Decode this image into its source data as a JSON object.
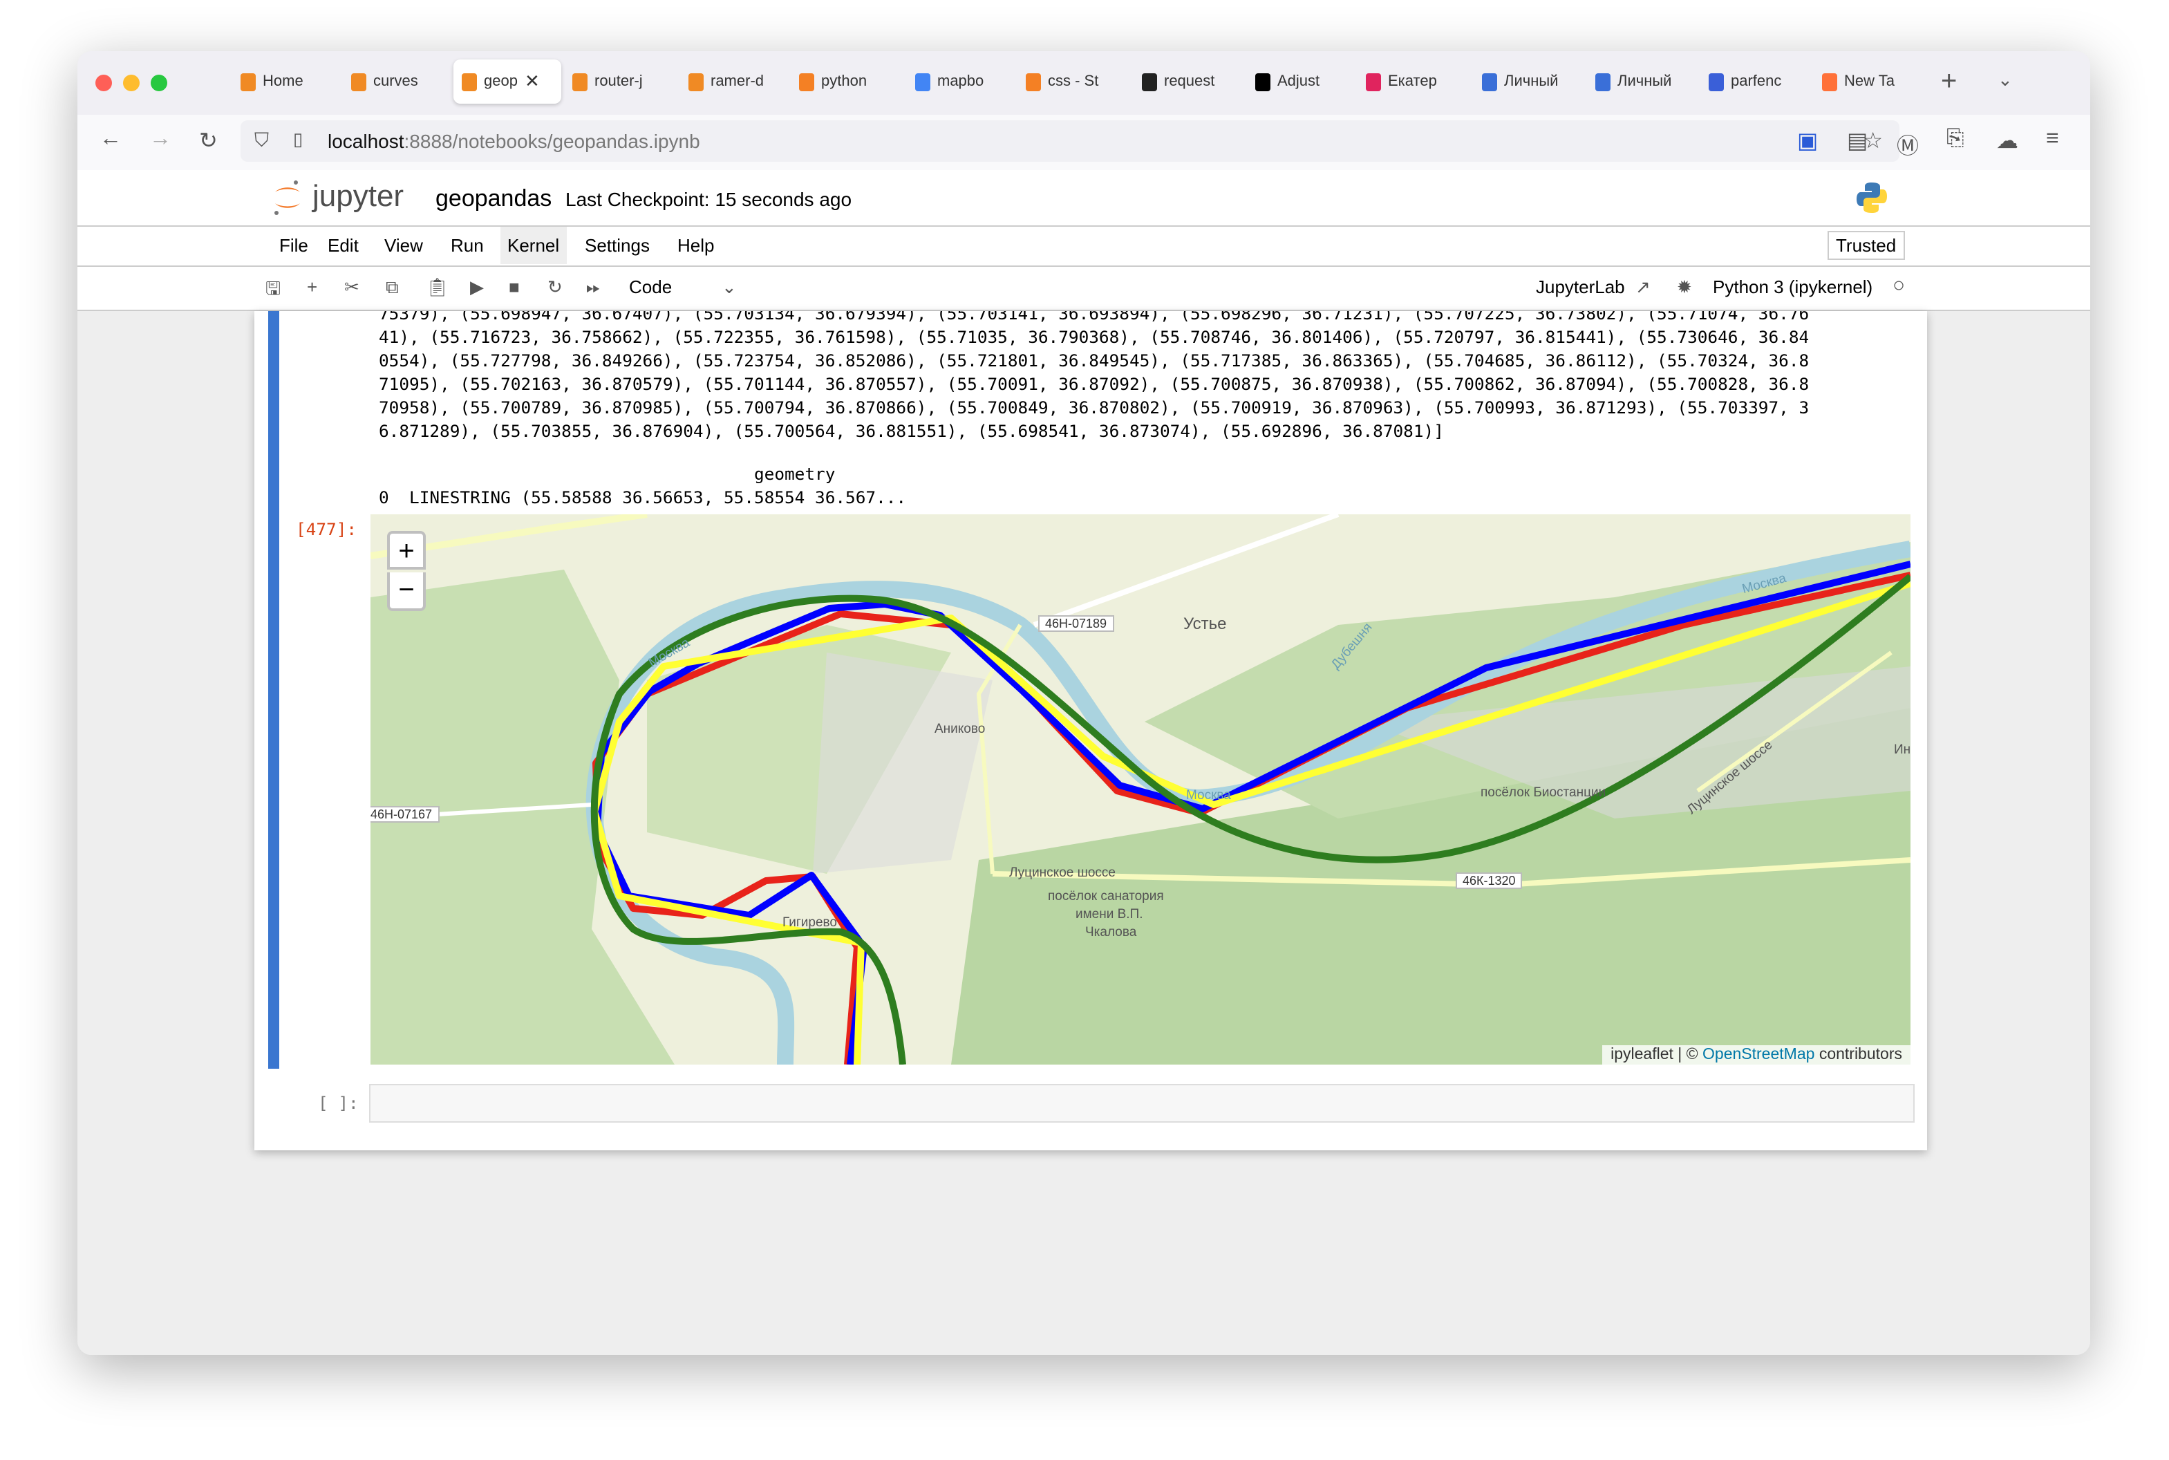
{
  "browser": {
    "tabs": [
      {
        "label": "Home",
        "icon": "jupyter-icon"
      },
      {
        "label": "curves",
        "icon": "jupyter-icon"
      },
      {
        "label": "geop",
        "icon": "jupyter-icon",
        "active": true
      },
      {
        "label": "router-j",
        "icon": "jupyter-icon"
      },
      {
        "label": "ramer-d",
        "icon": "jupyter-icon"
      },
      {
        "label": "python",
        "icon": "stackoverflow-icon"
      },
      {
        "label": "mapbo",
        "icon": "google-icon"
      },
      {
        "label": "css - St",
        "icon": "stackoverflow-icon"
      },
      {
        "label": "request",
        "icon": "github-icon"
      },
      {
        "label": "Adjust",
        "icon": "adjust-icon"
      },
      {
        "label": "Екатер",
        "icon": "app-icon"
      },
      {
        "label": "Личный",
        "icon": "chrome-like-icon"
      },
      {
        "label": "Личный",
        "icon": "chrome-like-icon"
      },
      {
        "label": "parfenc",
        "icon": "circle-icon"
      },
      {
        "label": "New Ta",
        "icon": "firefox-icon"
      }
    ],
    "url_host": "localhost",
    "url_rest": ":8888/notebooks/geopandas.ipynb"
  },
  "jupyter": {
    "logo": "jupyter",
    "notebook_name": "geopandas",
    "checkpoint": "Last Checkpoint: 15 seconds ago",
    "menu": [
      "File",
      "Edit",
      "View",
      "Run",
      "Kernel",
      "Settings",
      "Help"
    ],
    "active_menu": "Kernel",
    "trusted": "Trusted",
    "cell_type": "Code",
    "jupyterlab_link": "JupyterLab",
    "kernel": "Python 3 (ipykernel)"
  },
  "cells": {
    "output_lines": [
      "75379), (55.698947, 36.67407), (55.703134, 36.679394), (55.703141, 36.693894), (55.698296, 36.71231), (55.707225, 36.73802), (55.71074, 36.76",
      "41), (55.716723, 36.758662), (55.722355, 36.761598), (55.71035, 36.790368), (55.708746, 36.801406), (55.720797, 36.815441), (55.730646, 36.84",
      "0554), (55.727798, 36.849266), (55.723754, 36.852086), (55.721801, 36.849545), (55.717385, 36.863365), (55.704685, 36.86112), (55.70324, 36.8",
      "71095), (55.702163, 36.870579), (55.701144, 36.870557), (55.70091, 36.87092), (55.700875, 36.870938), (55.700862, 36.87094), (55.700828, 36.8",
      "70958), (55.700789, 36.870985), (55.700794, 36.870866), (55.700849, 36.870802), (55.700919, 36.870963), (55.700993, 36.871293), (55.703397, 3",
      "6.871289), (55.703855, 36.876904), (55.700564, 36.881551), (55.698541, 36.873074), (55.692896, 36.87081)]"
    ],
    "df_header": "                                     geometry",
    "df_row": "0  LINESTRING (55.58588 36.56653, 55.58554 36.567...",
    "prompt_executed": "[477]:",
    "prompt_empty": "[ ]:"
  },
  "map": {
    "zoom_in": "+",
    "zoom_out": "−",
    "attribution_prefix": "ipyleaflet | ©",
    "attribution_link": "OpenStreetMap",
    "attribution_suffix": "contributors",
    "labels": {
      "river1": "Москва",
      "river2": "Москва",
      "river3": "Москва",
      "ustye": "Устье",
      "dubeshnya": "Дубешня",
      "anikovo": "Аниково",
      "road1": "46Н-07189",
      "road2": "46Н-07167",
      "road3": "46К-1320",
      "lucinskoe": "Луцинское шоссе",
      "lucinskoe2": "Луцинское шоссе",
      "sanatorium": "посёлок санатория",
      "sanatorium2": "имени В.П.",
      "sanatorium3": "Чкалова",
      "biostation": "посёлок Биостанции",
      "gigirevo": "Гигирево",
      "in": "Ин"
    },
    "line_colors": {
      "original": "#e8231a",
      "simplified_a": "#0000ff",
      "simplified_b": "#ffff33",
      "smoothed": "#2e7d1f"
    }
  }
}
